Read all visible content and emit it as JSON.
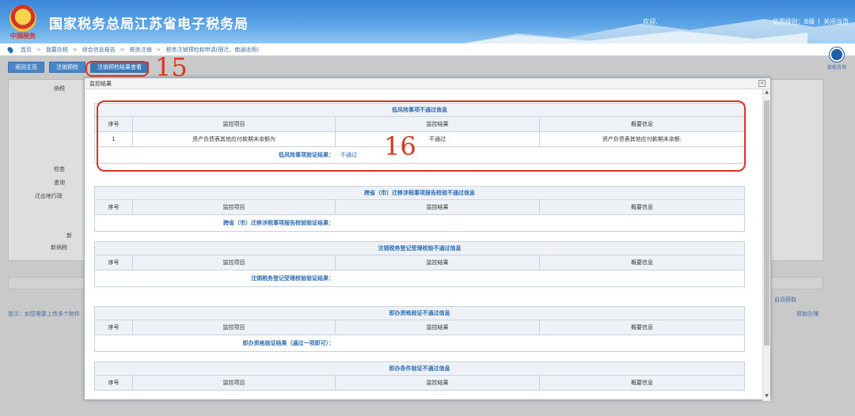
{
  "header": {
    "site_title": "国家税务总局江苏省电子税务局",
    "logo_caption": "中国税务",
    "welcome": "欢迎,",
    "credit_level": "信用级别：B级",
    "divider": "|",
    "close_page": "关闭当页"
  },
  "breadcrumb": [
    "首页",
    "我要办税",
    "综合信息报告",
    "税务注销",
    "税务注销预检和申请(宿迁、南通适用)"
  ],
  "breadcrumb_sep": ">",
  "toolbar": {
    "back_home": "返回主页",
    "pre_check": "注销预检",
    "view_result": "注销预检结果查看"
  },
  "helper": {
    "label": "智能咨询"
  },
  "annotations": {
    "a15": "15",
    "a16": "16"
  },
  "background": {
    "labels": [
      "纳税",
      "检查",
      "查询",
      "迁出地行政",
      "新",
      "新纳税"
    ],
    "tip": "提示：如您需要上传多个附件",
    "auto_fetch": "自动获取",
    "assist": "帮助办理"
  },
  "modal": {
    "title": "监控结果",
    "close_symbol": "×",
    "columns": {
      "seq": "序号",
      "item": "监控项目",
      "result": "监控结果",
      "summary": "概要信息"
    },
    "sections": [
      {
        "title": "低风险事项不通过信息",
        "rows": [
          {
            "seq": "1",
            "item": "资产负债表其他应付款期末余额为",
            "result": "不通过",
            "summary": "资产负债表其他应付款期末余额:"
          }
        ],
        "result_label": "低风险事项验证结果：",
        "result_value": "不通过"
      },
      {
        "title": "跨省（市）迁移涉税事项报告校验不通过信息",
        "rows": [],
        "result_label": "跨省（市）迁移涉税事项报告校验验证结果：",
        "result_value": ""
      },
      {
        "title": "注销税务登记受理校验不通过信息",
        "rows": [],
        "result_label": "注销税务登记受理校验验证结果：",
        "result_value": ""
      },
      {
        "title": "即办资格验证不通过信息",
        "rows": [],
        "result_label": "即办资格验证结果（通过一项即可）：",
        "result_value": ""
      },
      {
        "title": "即办条件验证不通过信息",
        "rows": [],
        "result_label": "",
        "result_value": ""
      }
    ]
  },
  "colors": {
    "accent": "#2c6cb6",
    "annotation": "#d9341f",
    "header": "#3b86d8"
  }
}
